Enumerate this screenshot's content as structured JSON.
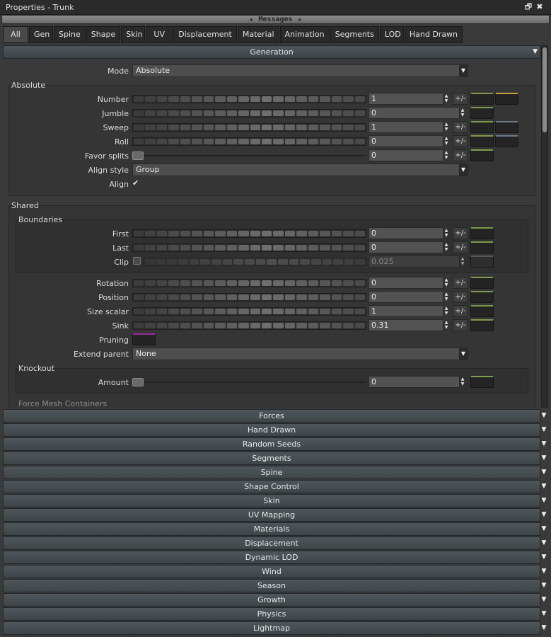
{
  "window": {
    "title": "Properties - Trunk",
    "restore_icon": "restore-window-icon",
    "close_icon": "close-icon"
  },
  "messages_bar": {
    "label": "Messages"
  },
  "tabs": [
    "All",
    "Gen",
    "Spine",
    "Shape",
    "Skin",
    "UV",
    "Displacement",
    "Material",
    "Animation",
    "Segments",
    "LOD",
    "Hand Drawn"
  ],
  "active_tab": "All",
  "generation": {
    "header": "Generation",
    "mode_label": "Mode",
    "mode_value": "Absolute",
    "absolute_group": "Absolute",
    "rows": {
      "number": {
        "label": "Number",
        "value": "1"
      },
      "jumble": {
        "label": "Jumble",
        "value": "0"
      },
      "sweep": {
        "label": "Sweep",
        "value": "1"
      },
      "roll": {
        "label": "Roll",
        "value": "0"
      },
      "favor_splits": {
        "label": "Favor splits",
        "value": "0"
      }
    },
    "align_style_label": "Align style",
    "align_style_value": "Group",
    "align_label": "Align",
    "align_checked": "✔",
    "pm_label": "+/-",
    "shared_group": "Shared",
    "boundaries_group": "Boundaries",
    "boundary_rows": {
      "first": {
        "label": "First",
        "value": "0"
      },
      "last": {
        "label": "Last",
        "value": "0"
      },
      "clip": {
        "label": "Clip",
        "value": "0.025"
      }
    },
    "shared_rows": {
      "rotation": {
        "label": "Rotation",
        "value": "0"
      },
      "position": {
        "label": "Position",
        "value": "0"
      },
      "size_scalar": {
        "label": "Size scalar",
        "value": "1"
      },
      "sink": {
        "label": "Sink",
        "value": "0.31"
      }
    },
    "pruning_label": "Pruning",
    "extend_parent_label": "Extend parent",
    "extend_parent_value": "None",
    "knockout_group": "Knockout",
    "amount_label": "Amount",
    "amount_value": "0",
    "force_mesh_label": "Force Mesh Containers"
  },
  "collapsed_sections": [
    "Forces",
    "Hand Drawn",
    "Random Seeds",
    "Segments",
    "Spine",
    "Shape Control",
    "Skin",
    "UV Mapping",
    "Materials",
    "Displacement",
    "Dynamic LOD",
    "Wind",
    "Season",
    "Growth",
    "Physics",
    "Lightmap"
  ],
  "colors": {
    "curve_green": "#7e9a4e",
    "curve_gold": "#c8a03a",
    "curve_purple": "#9a2a9a",
    "header": "#4a5156"
  }
}
